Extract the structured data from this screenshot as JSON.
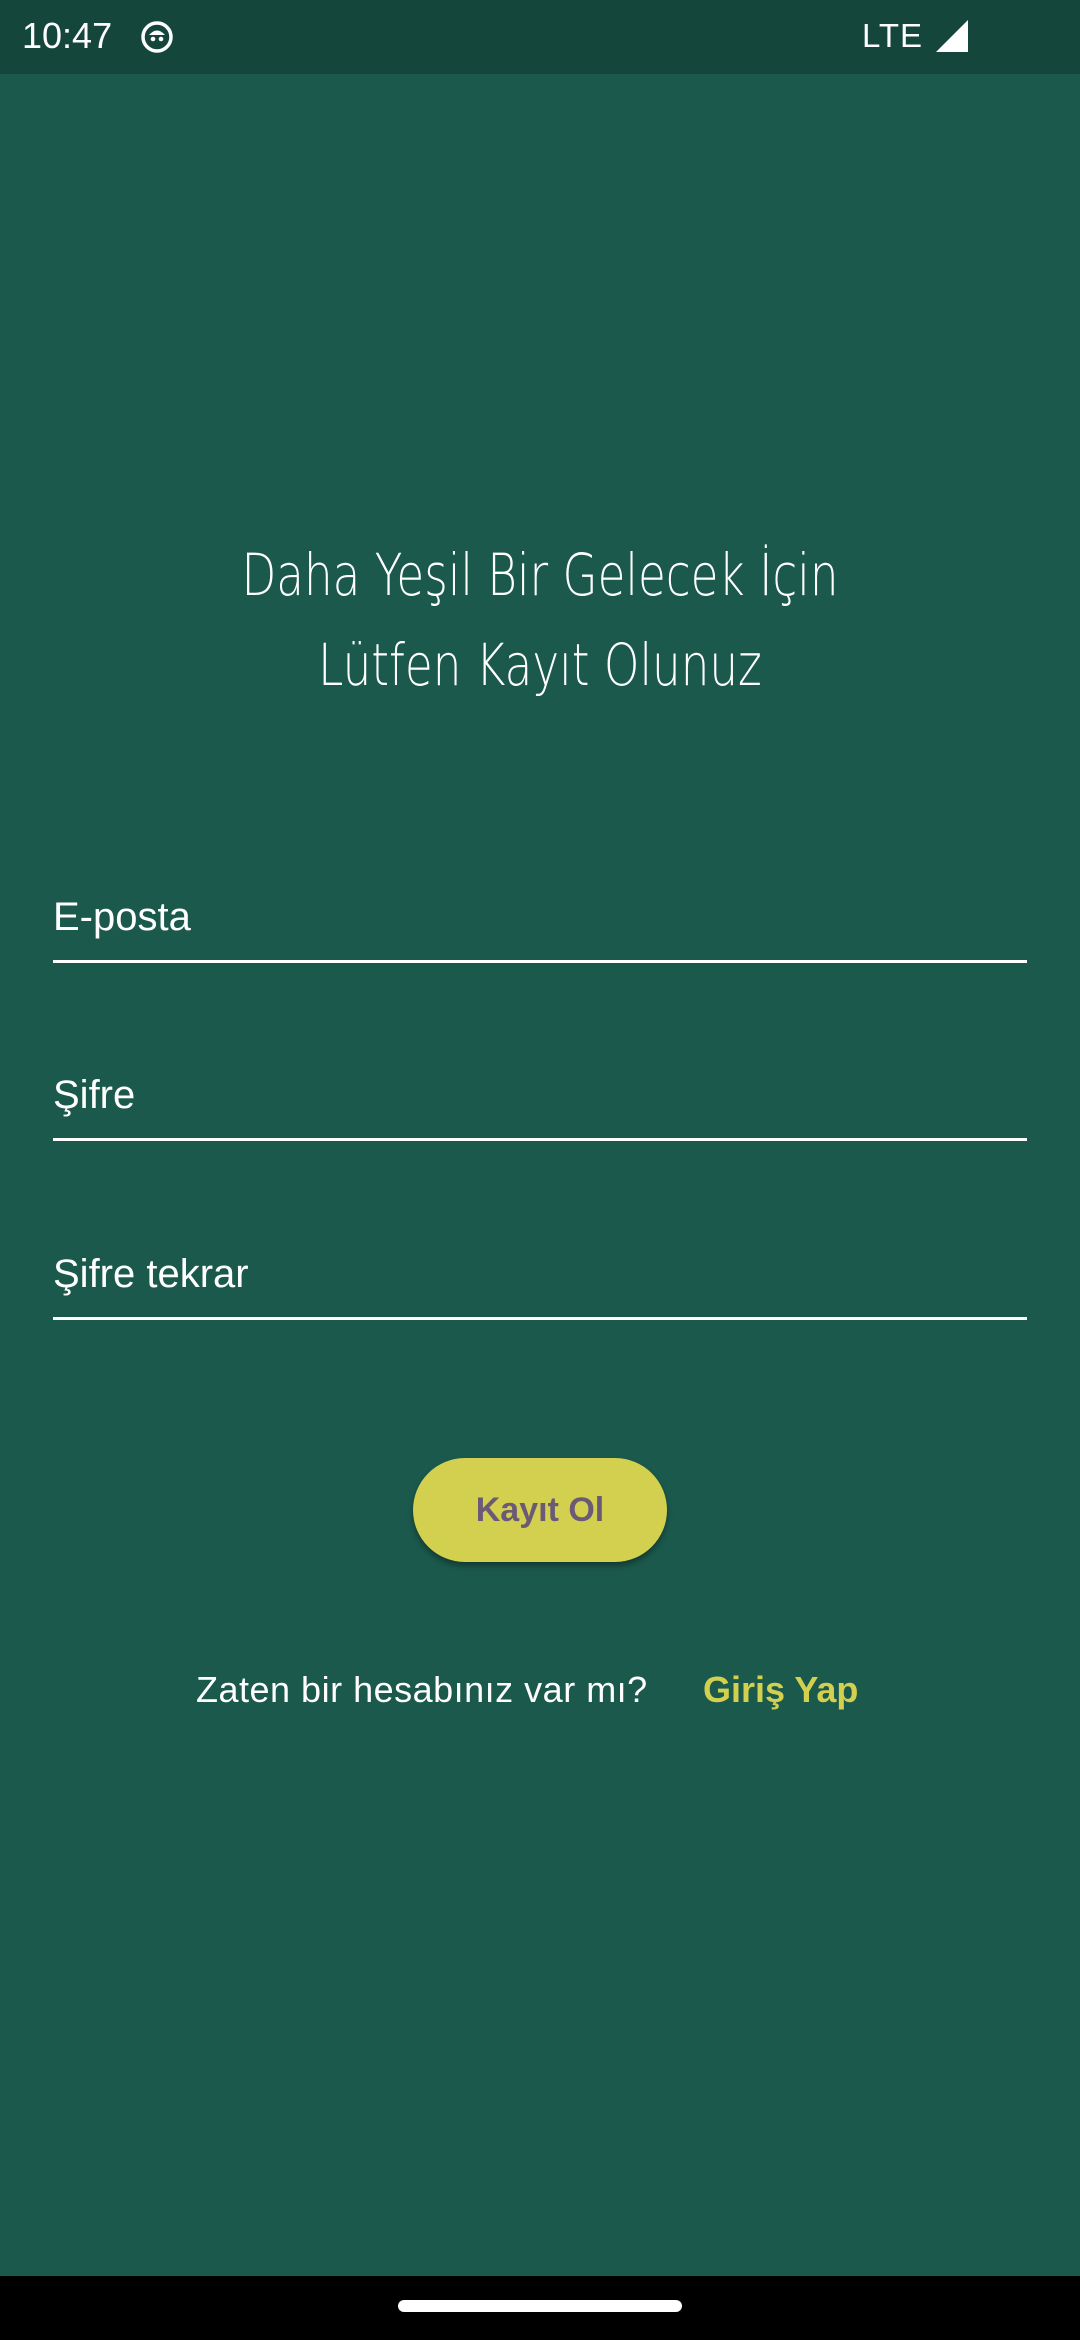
{
  "status_bar": {
    "time": "10:47",
    "network": "LTE",
    "icons": [
      "app-notification-icon",
      "signal-icon"
    ]
  },
  "title": {
    "line1": "Daha Yeşil Bir Gelecek İçin",
    "line2": "Lütfen Kayıt Olunuz"
  },
  "form": {
    "email": {
      "placeholder": "E-posta",
      "value": ""
    },
    "password": {
      "placeholder": "Şifre",
      "value": ""
    },
    "password_repeat": {
      "placeholder": "Şifre tekrar",
      "value": ""
    },
    "submit_label": "Kayıt Ol"
  },
  "login": {
    "prompt": "Zaten bir hesabınız var mı?",
    "link_label": "Giriş Yap"
  },
  "colors": {
    "background": "#1b594c",
    "status_bar": "#15463c",
    "accent": "#d2d04e",
    "button_text": "#6b5a76",
    "text": "#ffffff"
  }
}
